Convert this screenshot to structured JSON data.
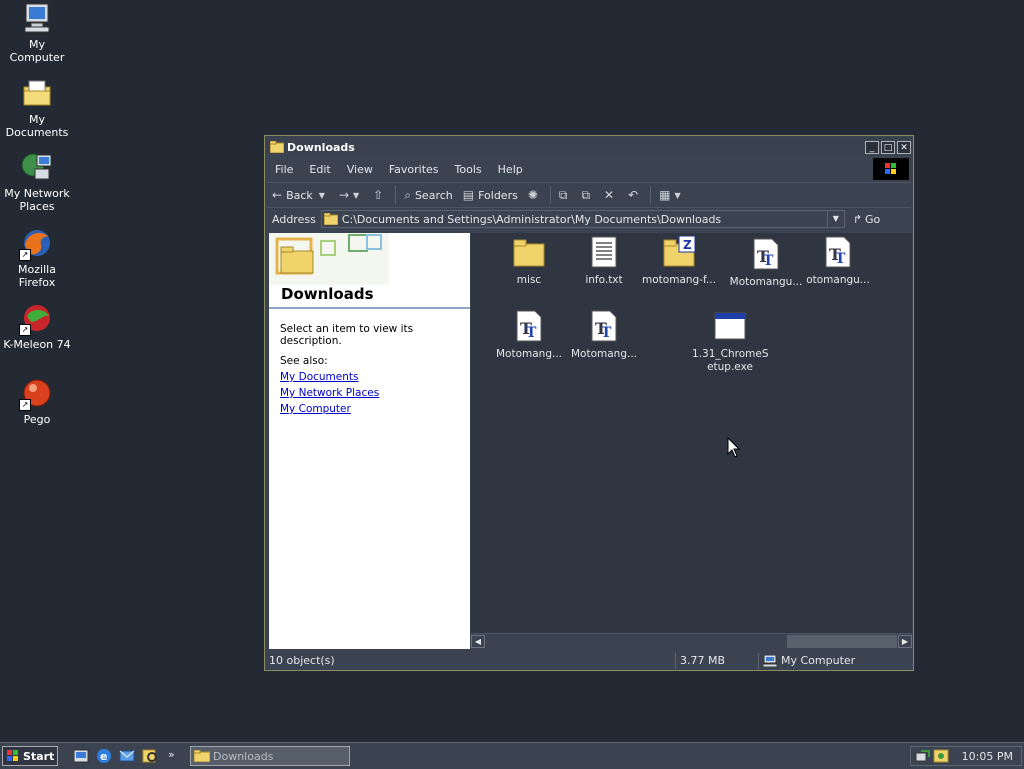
{
  "desktop": {
    "icons": [
      {
        "label": "My Computer",
        "icon": "my-computer-icon"
      },
      {
        "label": "My Documents",
        "icon": "my-documents-icon"
      },
      {
        "label": "My Network\nPlaces",
        "label_line1": "My Network",
        "label_line2": "Places",
        "icon": "network-places-icon"
      },
      {
        "label": "Mozilla Firefox",
        "icon": "firefox-icon"
      },
      {
        "label": "K-Meleon 74",
        "icon": "k-meleon-icon"
      },
      {
        "label": "Pego",
        "icon": "pego-icon"
      }
    ]
  },
  "window": {
    "title": "Downloads",
    "menu": [
      "File",
      "Edit",
      "View",
      "Favorites",
      "Tools",
      "Help"
    ],
    "toolbar": {
      "back": "Back",
      "search": "Search",
      "folders": "Folders"
    },
    "address": {
      "label": "Address",
      "path": "C:\\Documents and Settings\\Administrator\\My Documents\\Downloads",
      "go": "Go"
    },
    "left_pane": {
      "title": "Downloads",
      "description": "Select an item to view its description.",
      "see_also": "See also:",
      "links": [
        "My Documents",
        "My Network Places",
        "My Computer"
      ]
    },
    "files": [
      {
        "name": "misc",
        "type": "folder"
      },
      {
        "name": "info.txt",
        "type": "text"
      },
      {
        "name": "motomang-f...",
        "type": "zip-folder"
      },
      {
        "name": "Motomangu...",
        "type": "font"
      },
      {
        "name": "otomangu...",
        "type": "font"
      },
      {
        "name": "Motomang...",
        "type": "font"
      },
      {
        "name": "Motomang...",
        "type": "font"
      },
      {
        "name": "1.31_ChromeSetup.exe",
        "name_line1": "1.31_ChromeS",
        "name_line2": "etup.exe",
        "type": "exe"
      }
    ],
    "status": {
      "objects": "10 object(s)",
      "size": "3.77 MB",
      "location": "My Computer"
    }
  },
  "taskbar": {
    "start": "Start",
    "task": "Downloads",
    "clock": "10:05 PM",
    "chevron": "»"
  },
  "colors": {
    "desktop": "#232a33",
    "window": "#3b4350",
    "link": "#0000cc"
  }
}
